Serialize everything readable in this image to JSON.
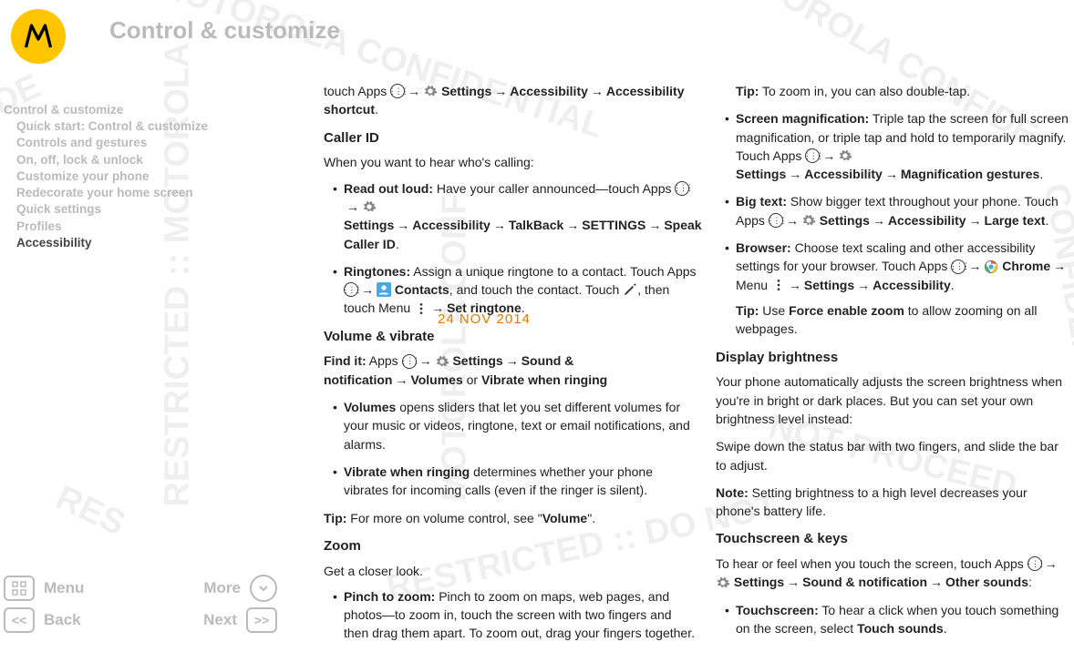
{
  "header": {
    "title": "Control & customize"
  },
  "sidebar": {
    "items": [
      {
        "label": "Control & customize",
        "indent": false,
        "active": false
      },
      {
        "label": "Quick start: Control & customize",
        "indent": true,
        "active": false
      },
      {
        "label": "Controls and gestures",
        "indent": true,
        "active": false
      },
      {
        "label": "On, off, lock & unlock",
        "indent": true,
        "active": false
      },
      {
        "label": "Customize your phone",
        "indent": true,
        "active": false
      },
      {
        "label": "Redecorate your home screen",
        "indent": true,
        "active": false
      },
      {
        "label": "Quick settings",
        "indent": true,
        "active": false
      },
      {
        "label": "Profiles",
        "indent": true,
        "active": false
      },
      {
        "label": "Accessibility",
        "indent": true,
        "active": true
      }
    ]
  },
  "footer": {
    "menu": "Menu",
    "more": "More",
    "back": "Back",
    "next": "Next"
  },
  "date_stamp": "24 NOV 2014",
  "left_col": {
    "intro_a": "touch Apps ",
    "intro_b_settings": "Settings",
    "intro_b_acc": "Accessibility",
    "intro_b_short": "Accessibility shortcut",
    "caller_id_h": "Caller ID",
    "caller_id_p": "When you want to hear who's calling:",
    "read_label": "Read out loud:",
    "read_text_a": " Have your caller announced—touch Apps ",
    "read_settings": "Settings",
    "read_acc": "Accessibility",
    "read_talkback": "TalkBack",
    "read_settings2": "SETTINGS",
    "read_speak": "Speak Caller ID",
    "ring_label": "Ringtones:",
    "ring_text_a": " Assign a unique ringtone to a contact. Touch Apps ",
    "ring_contacts": "Contacts",
    "ring_text_b": ", and touch the contact. Touch ",
    "ring_text_c": ", then touch Menu ",
    "ring_set": "Set ringtone",
    "vol_h": "Volume & vibrate",
    "vol_find": "Find it:",
    "vol_find_a": " Apps ",
    "vol_settings": "Settings",
    "vol_sound": "Sound & notification",
    "vol_volumes": "Volumes",
    "vol_or": " or ",
    "vol_vibrate": "Vibrate when ringing",
    "vol_b1_label": "Volumes",
    "vol_b1_text": " opens sliders that let you set different volumes for your music or videos, ringtone, text or email notifications, and alarms.",
    "vol_b2_label": "Vibrate when ringing",
    "vol_b2_text": " determines whether your phone vibrates for incoming calls (even if the ringer is silent).",
    "vol_tip": "Tip:",
    "vol_tip_a": " For more on volume control, see \"",
    "vol_tip_link": "Volume",
    "vol_tip_b": "\".",
    "zoom_h": "Zoom",
    "zoom_p": "Get a closer look.",
    "zoom_b1_label": "Pinch to zoom:",
    "zoom_b1_text": " Pinch to zoom on maps, web pages, and photos—to zoom in, touch the screen with two fingers and then drag them apart. To zoom out, drag your fingers together."
  },
  "right_col": {
    "tip1": "Tip:",
    "tip1_text": " To zoom in, you can also double-tap.",
    "mag_label": "Screen magnification:",
    "mag_text_a": " Triple tap the screen for full screen magnification, or triple tap and hold to temporarily magnify. Touch Apps ",
    "mag_settings": "Settings",
    "mag_acc": "Accessibility",
    "mag_gest": "Magnification gestures",
    "big_label": "Big text:",
    "big_text_a": " Show bigger text throughout your phone. Touch Apps ",
    "big_settings": "Settings",
    "big_acc": "Accessibility",
    "big_large": "Large text",
    "brow_label": "Browser:",
    "brow_text_a": " Choose text scaling and other accessibility settings for your browser. Touch Apps ",
    "brow_chrome": "Chrome",
    "brow_menu": " Menu ",
    "brow_settings": "Settings",
    "brow_acc": "Accessibility",
    "brow_tip": "Tip:",
    "brow_tip_a": " Use ",
    "brow_tip_force": "Force enable zoom",
    "brow_tip_b": " to allow zooming on all webpages.",
    "disp_h": "Display brightness",
    "disp_p1": "Your phone automatically adjusts the screen brightness when you're in bright or dark places. But you can set your own brightness level instead:",
    "disp_p2": "Swipe down the status bar with two fingers, and slide the bar to adjust.",
    "disp_note": "Note:",
    "disp_note_t": " Setting brightness to a high level decreases your phone's battery life.",
    "touch_h": "Touchscreen & keys",
    "touch_p_a": "To hear or feel when you touch the screen, touch Apps ",
    "touch_settings": "Settings",
    "touch_sound": "Sound & notification",
    "touch_other": "Other sounds",
    "touch_b1_label": "Touchscreen:",
    "touch_b1_text": " To hear a click when you touch something on the screen, select ",
    "touch_b1_sounds": "Touch sounds"
  }
}
